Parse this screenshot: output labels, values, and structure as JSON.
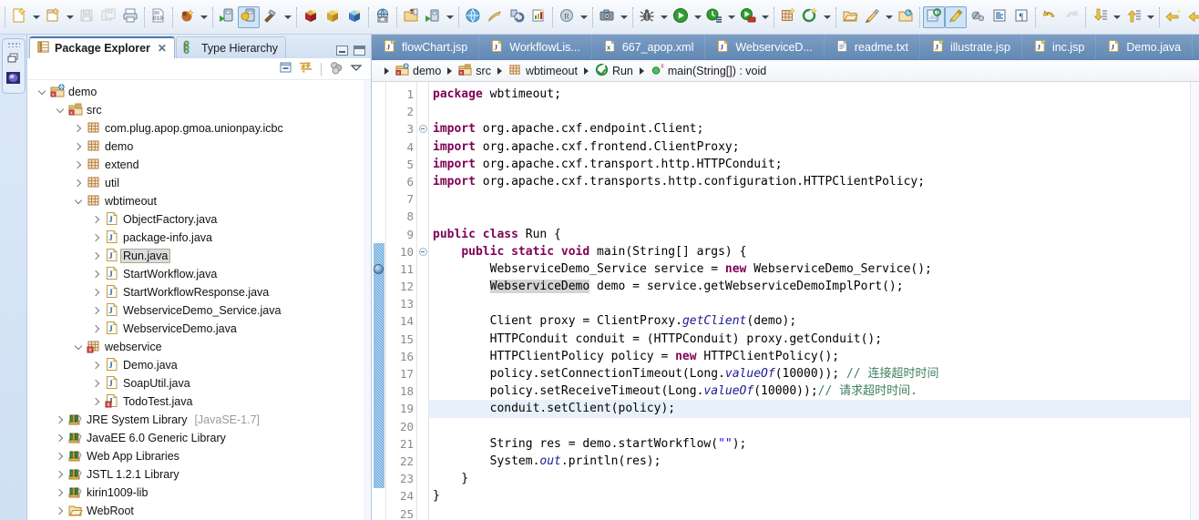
{
  "toolbar": {
    "groups": [
      {
        "items": [
          {
            "name": "new-wizard",
            "icon": "new-file-icon",
            "dropdown": true
          },
          {
            "name": "new-java-class",
            "icon": "new-class-icon",
            "dropdown": true
          },
          {
            "name": "save",
            "icon": "save-icon",
            "dropdown": false,
            "disabled": true
          },
          {
            "name": "save-all",
            "icon": "save-all-icon",
            "dropdown": false,
            "disabled": true
          },
          {
            "name": "print",
            "icon": "print-icon",
            "dropdown": false
          }
        ]
      },
      {
        "items": [
          {
            "name": "toggle-binary",
            "icon": "binary-file-icon",
            "dropdown": false
          }
        ]
      },
      {
        "items": [
          {
            "name": "new-ant-build",
            "icon": "ant-build-icon",
            "dropdown": true
          }
        ]
      },
      {
        "items": [
          {
            "name": "run-server",
            "icon": "run-server-icon",
            "dropdown": false
          },
          {
            "name": "debug-server",
            "icon": "debug-server-icon",
            "dropdown": false,
            "selected": true
          },
          {
            "name": "build-hammer",
            "icon": "hammer-icon",
            "dropdown": true
          }
        ]
      },
      {
        "items": [
          {
            "name": "package-red",
            "icon": "package-red-icon",
            "dropdown": false
          },
          {
            "name": "package-gold",
            "icon": "package-gold-icon",
            "dropdown": false
          },
          {
            "name": "package-blue",
            "icon": "package-blue-icon",
            "dropdown": false
          }
        ]
      },
      {
        "items": [
          {
            "name": "web20-tools",
            "icon": "web-globe-20-icon",
            "dropdown": false
          }
        ]
      },
      {
        "items": [
          {
            "name": "import-project",
            "icon": "import-folder-icon",
            "dropdown": false
          },
          {
            "name": "run-deploy",
            "icon": "run-deploy-icon",
            "dropdown": true
          }
        ]
      },
      {
        "items": [
          {
            "name": "open-browser",
            "icon": "globe-icon",
            "dropdown": false
          },
          {
            "name": "publish",
            "icon": "publish-icon",
            "dropdown": false
          },
          {
            "name": "refresh-server",
            "icon": "refresh-server-icon",
            "dropdown": false
          },
          {
            "name": "report",
            "icon": "report-icon",
            "dropdown": false
          }
        ]
      },
      {
        "items": [
          {
            "name": "javadoc",
            "icon": "javadoc-globe-icon",
            "dropdown": true
          }
        ]
      },
      {
        "items": [
          {
            "name": "screenshot",
            "icon": "camera-icon",
            "dropdown": true
          }
        ]
      },
      {
        "items": [
          {
            "name": "debug",
            "icon": "debug-bug-icon",
            "dropdown": true
          },
          {
            "name": "run",
            "icon": "run-green-play-icon",
            "dropdown": true
          },
          {
            "name": "run-history",
            "icon": "run-history-icon",
            "dropdown": true
          },
          {
            "name": "run-coverage",
            "icon": "coverage-icon",
            "dropdown": true
          }
        ]
      },
      {
        "items": [
          {
            "name": "new-package",
            "icon": "new-package-icon",
            "dropdown": false
          },
          {
            "name": "new-annotation",
            "icon": "new-annotation-icon",
            "dropdown": true
          }
        ]
      },
      {
        "items": [
          {
            "name": "open-type",
            "icon": "open-type-icon",
            "dropdown": false
          },
          {
            "name": "open-task",
            "icon": "open-task-icon",
            "dropdown": true
          },
          {
            "name": "search",
            "icon": "search-icon",
            "dropdown": false
          }
        ]
      },
      {
        "items": [
          {
            "name": "link-with-editor",
            "icon": "link-editor-icon",
            "dropdown": false,
            "selected": true
          },
          {
            "name": "mark-occurrences",
            "icon": "marker-pen-icon",
            "dropdown": false,
            "selected": true
          },
          {
            "name": "skip-breakpoints",
            "icon": "skip-breakpoints-icon",
            "dropdown": false
          },
          {
            "name": "show-whitespace",
            "icon": "show-source-icon",
            "dropdown": false
          },
          {
            "name": "show-formatting",
            "icon": "pilcrow-icon",
            "dropdown": false
          }
        ]
      },
      {
        "items": [
          {
            "name": "undo",
            "icon": "undo-arrow-icon",
            "dropdown": false
          },
          {
            "name": "redo",
            "icon": "redo-arrow-icon",
            "dropdown": false,
            "disabled": true
          }
        ]
      },
      {
        "items": [
          {
            "name": "next-annotation",
            "icon": "next-annotation-icon",
            "dropdown": true
          },
          {
            "name": "previous-annotation",
            "icon": "previous-annotation-icon",
            "dropdown": true
          }
        ]
      },
      {
        "items": [
          {
            "name": "last-edit-location",
            "icon": "last-edit-icon",
            "dropdown": false
          },
          {
            "name": "back",
            "icon": "back-arrow-icon",
            "dropdown": true
          },
          {
            "name": "forward",
            "icon": "forward-arrow-icon",
            "dropdown": false,
            "disabled": true
          }
        ]
      }
    ]
  },
  "fast_view_bar": {
    "items": [
      {
        "name": "restore-perspective",
        "icon": "restore-window-icon"
      },
      {
        "name": "perspective-thumb",
        "icon": "perspective-icon"
      }
    ]
  },
  "left_panel": {
    "tabs": [
      {
        "label": "Package Explorer",
        "icon": "package-explorer-icon",
        "active": true,
        "closable": true
      },
      {
        "label": "Type Hierarchy",
        "icon": "type-hierarchy-icon",
        "active": false,
        "closable": false
      }
    ],
    "window_buttons": [
      {
        "name": "minimize-view-button",
        "icon": "minimize-icon"
      },
      {
        "name": "maximize-view-button",
        "icon": "maximize-icon"
      }
    ],
    "view_toolbar": [
      {
        "name": "collapse-all-button",
        "icon": "collapse-all-icon"
      },
      {
        "name": "link-with-editor-button",
        "icon": "link-with-editor-icon"
      },
      {
        "name": "view-menu-filters-button",
        "icon": "filters-icon"
      },
      {
        "name": "view-menu-button",
        "icon": "chevron-down-icon"
      }
    ],
    "tree": [
      {
        "label": "demo",
        "indent": 0,
        "icon": "java-project-icon",
        "twisty": "down"
      },
      {
        "label": "src",
        "indent": 1,
        "icon": "source-folder-icon",
        "twisty": "down"
      },
      {
        "label": "com.plug.apop.gmoa.unionpay.icbc",
        "indent": 2,
        "icon": "package-icon",
        "twisty": "right"
      },
      {
        "label": "demo",
        "indent": 2,
        "icon": "package-icon",
        "twisty": "right"
      },
      {
        "label": "extend",
        "indent": 2,
        "icon": "package-icon",
        "twisty": "right"
      },
      {
        "label": "util",
        "indent": 2,
        "icon": "package-icon",
        "twisty": "right"
      },
      {
        "label": "wbtimeout",
        "indent": 2,
        "icon": "package-icon",
        "twisty": "down"
      },
      {
        "label": "ObjectFactory.java",
        "indent": 3,
        "icon": "java-file-icon",
        "twisty": "right"
      },
      {
        "label": "package-info.java",
        "indent": 3,
        "icon": "java-file-icon",
        "twisty": "right"
      },
      {
        "label": "Run.java",
        "indent": 3,
        "icon": "java-file-icon",
        "twisty": "right",
        "selected": true
      },
      {
        "label": "StartWorkflow.java",
        "indent": 3,
        "icon": "java-file-icon",
        "twisty": "right"
      },
      {
        "label": "StartWorkflowResponse.java",
        "indent": 3,
        "icon": "java-file-icon",
        "twisty": "right"
      },
      {
        "label": "WebserviceDemo_Service.java",
        "indent": 3,
        "icon": "java-file-icon",
        "twisty": "right"
      },
      {
        "label": "WebserviceDemo.java",
        "indent": 3,
        "icon": "java-file-icon",
        "twisty": "right"
      },
      {
        "label": "webservice",
        "indent": 2,
        "icon": "package-error-icon",
        "twisty": "down"
      },
      {
        "label": "Demo.java",
        "indent": 3,
        "icon": "java-file-icon",
        "twisty": "right"
      },
      {
        "label": "SoapUtil.java",
        "indent": 3,
        "icon": "java-file-icon",
        "twisty": "right"
      },
      {
        "label": "TodoTest.java",
        "indent": 3,
        "icon": "java-file-error-icon",
        "twisty": "right"
      },
      {
        "label": "JRE System Library",
        "suffix": "[JavaSE-1.7]",
        "indent": 1,
        "icon": "library-icon",
        "twisty": "right"
      },
      {
        "label": "JavaEE 6.0 Generic Library",
        "indent": 1,
        "icon": "library-icon",
        "twisty": "right"
      },
      {
        "label": "Web App Libraries",
        "indent": 1,
        "icon": "library-icon",
        "twisty": "right"
      },
      {
        "label": "JSTL 1.2.1 Library",
        "indent": 1,
        "icon": "library-icon",
        "twisty": "right"
      },
      {
        "label": "kirin1009-lib",
        "indent": 1,
        "icon": "library-icon",
        "twisty": "right"
      },
      {
        "label": "WebRoot",
        "indent": 1,
        "icon": "folder-icon",
        "twisty": "right"
      }
    ]
  },
  "editor": {
    "tabs": [
      {
        "label": "flowChart.jsp",
        "icon": "jsp-file-icon"
      },
      {
        "label": "WorkflowLis...",
        "icon": "java-file-icon"
      },
      {
        "label": "667_apop.xml",
        "icon": "xml-file-icon"
      },
      {
        "label": "WebserviceD...",
        "icon": "java-file-icon"
      },
      {
        "label": "readme.txt",
        "icon": "text-file-icon"
      },
      {
        "label": "illustrate.jsp",
        "icon": "jsp-file-icon"
      },
      {
        "label": "inc.jsp",
        "icon": "jsp-file-icon"
      },
      {
        "label": "Demo.java",
        "icon": "java-file-icon"
      }
    ],
    "breadcrumb": [
      {
        "label": "demo",
        "icon": "java-project-icon"
      },
      {
        "label": "src",
        "icon": "source-folder-icon"
      },
      {
        "label": "wbtimeout",
        "icon": "package-icon"
      },
      {
        "label": "Run",
        "icon": "java-class-icon"
      },
      {
        "label": "main(String[]) : void",
        "icon": "method-static-icon"
      }
    ],
    "first_line_number": 1,
    "last_line_number": 25,
    "highlighted_line": 19,
    "breakpoint_line": 11,
    "change_bar_from_line": 10,
    "change_bar_to_line": 23,
    "fold_lines": [
      3,
      10
    ],
    "lines": [
      {
        "n": 1,
        "tokens": [
          {
            "t": "package ",
            "c": "kw"
          },
          {
            "t": "wbtimeout;",
            "c": "plain"
          }
        ]
      },
      {
        "n": 2,
        "tokens": []
      },
      {
        "n": 3,
        "tokens": [
          {
            "t": "import ",
            "c": "kw"
          },
          {
            "t": "org.apache.cxf.endpoint.Client;",
            "c": "plain"
          }
        ]
      },
      {
        "n": 4,
        "tokens": [
          {
            "t": "import ",
            "c": "kw"
          },
          {
            "t": "org.apache.cxf.frontend.ClientProxy;",
            "c": "plain"
          }
        ]
      },
      {
        "n": 5,
        "tokens": [
          {
            "t": "import ",
            "c": "kw"
          },
          {
            "t": "org.apache.cxf.transport.http.HTTPConduit;",
            "c": "plain"
          }
        ]
      },
      {
        "n": 6,
        "tokens": [
          {
            "t": "import ",
            "c": "kw"
          },
          {
            "t": "org.apache.cxf.transports.http.configuration.HTTPClientPolicy;",
            "c": "plain"
          }
        ]
      },
      {
        "n": 7,
        "tokens": []
      },
      {
        "n": 8,
        "tokens": []
      },
      {
        "n": 9,
        "tokens": [
          {
            "t": "public class ",
            "c": "kw"
          },
          {
            "t": "Run {",
            "c": "plain"
          }
        ]
      },
      {
        "n": 10,
        "tokens": [
          {
            "t": "    ",
            "c": "plain"
          },
          {
            "t": "public static void ",
            "c": "kw"
          },
          {
            "t": "main(String[] args) {",
            "c": "plain"
          }
        ]
      },
      {
        "n": 11,
        "tokens": [
          {
            "t": "        WebserviceDemo_Service service = ",
            "c": "plain"
          },
          {
            "t": "new ",
            "c": "kw"
          },
          {
            "t": "WebserviceDemo_Service();",
            "c": "plain"
          }
        ]
      },
      {
        "n": 12,
        "tokens": [
          {
            "t": "        ",
            "c": "plain"
          },
          {
            "t": "WebserviceDemo",
            "c": "sel-token"
          },
          {
            "t": " demo = service.getWebserviceDemoImplPort();",
            "c": "plain"
          }
        ]
      },
      {
        "n": 13,
        "tokens": []
      },
      {
        "n": 14,
        "tokens": [
          {
            "t": "        Client proxy = ClientProxy.",
            "c": "plain"
          },
          {
            "t": "getClient",
            "c": "stat"
          },
          {
            "t": "(demo);",
            "c": "plain"
          }
        ]
      },
      {
        "n": 15,
        "tokens": [
          {
            "t": "        HTTPConduit conduit = (HTTPConduit) proxy.getConduit();",
            "c": "plain"
          }
        ]
      },
      {
        "n": 16,
        "tokens": [
          {
            "t": "        HTTPClientPolicy policy = ",
            "c": "plain"
          },
          {
            "t": "new ",
            "c": "kw"
          },
          {
            "t": "HTTPClientPolicy();",
            "c": "plain"
          }
        ]
      },
      {
        "n": 17,
        "tokens": [
          {
            "t": "        policy.setConnectionTimeout(Long.",
            "c": "plain"
          },
          {
            "t": "valueOf",
            "c": "stat"
          },
          {
            "t": "(10000)); ",
            "c": "plain"
          },
          {
            "t": "// 连接超时时间",
            "c": "cmt"
          }
        ]
      },
      {
        "n": 18,
        "tokens": [
          {
            "t": "        policy.setReceiveTimeout(Long.",
            "c": "plain"
          },
          {
            "t": "valueOf",
            "c": "stat"
          },
          {
            "t": "(10000));",
            "c": "plain"
          },
          {
            "t": "// 请求超时时间.",
            "c": "cmt"
          }
        ]
      },
      {
        "n": 19,
        "tokens": [
          {
            "t": "        conduit.setClient(policy);",
            "c": "plain"
          }
        ]
      },
      {
        "n": 20,
        "tokens": []
      },
      {
        "n": 21,
        "tokens": [
          {
            "t": "        String res = demo.startWorkflow(",
            "c": "plain"
          },
          {
            "t": "\"\"",
            "c": "str"
          },
          {
            "t": ");",
            "c": "plain"
          }
        ]
      },
      {
        "n": 22,
        "tokens": [
          {
            "t": "        System.",
            "c": "plain"
          },
          {
            "t": "out",
            "c": "stat"
          },
          {
            "t": ".println(res);",
            "c": "plain"
          }
        ]
      },
      {
        "n": 23,
        "tokens": [
          {
            "t": "    }",
            "c": "plain"
          }
        ]
      },
      {
        "n": 24,
        "tokens": [
          {
            "t": "}",
            "c": "plain"
          }
        ]
      },
      {
        "n": 25,
        "tokens": []
      }
    ]
  },
  "colors": {
    "keyword": "#7f0055",
    "string": "#2a00ff",
    "comment": "#3f7f5f",
    "static_field": "#1a1a8f",
    "tab_bar": "#6f93bd",
    "highlight_line": "#e8f1fb",
    "change_bar": "#6aaadd",
    "selection": "#d4d4d4"
  }
}
